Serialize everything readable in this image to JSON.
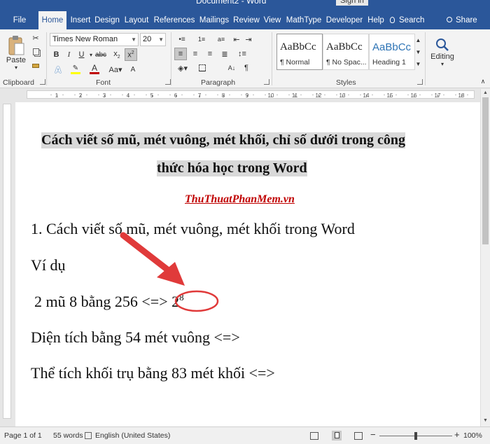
{
  "window": {
    "title": "Document2 - Word",
    "signin_label": "Sign in"
  },
  "tabs": [
    {
      "label": "File",
      "active": false
    },
    {
      "label": "Home",
      "active": true
    },
    {
      "label": "Insert",
      "active": false
    },
    {
      "label": "Design",
      "active": false
    },
    {
      "label": "Layout",
      "active": false
    },
    {
      "label": "References",
      "active": false
    },
    {
      "label": "Mailings",
      "active": false
    },
    {
      "label": "Review",
      "active": false
    },
    {
      "label": "View",
      "active": false
    },
    {
      "label": "MathType",
      "active": false
    },
    {
      "label": "Developer",
      "active": false
    },
    {
      "label": "Help",
      "active": false
    }
  ],
  "tell_me": {
    "icon": "lightbulb-icon",
    "label": "Search"
  },
  "share": {
    "icon": "person-icon",
    "label": "Share"
  },
  "ribbon": {
    "clipboard": {
      "paste_label": "Paste",
      "group_label": "Clipboard"
    },
    "font": {
      "name": "Times New Roman",
      "size": "20",
      "group_label": "Font",
      "font_color": "#c00000",
      "highlight_color": "#ffff00"
    },
    "paragraph": {
      "group_label": "Paragraph"
    },
    "styles": {
      "group_label": "Styles",
      "items": [
        {
          "sample": "AaBbCc",
          "name": "¶ Normal",
          "selected": true
        },
        {
          "sample": "AaBbCc",
          "name": "¶ No Spac...",
          "selected": false
        },
        {
          "sample": "AaBbCc",
          "name": "Heading 1",
          "selected": false,
          "color": "#2e74b5"
        }
      ]
    },
    "editing": {
      "label": "Editing"
    }
  },
  "ruler": {
    "marks": [
      "1",
      "2",
      "3",
      "4",
      "5",
      "6",
      "7",
      "8",
      "9",
      "10",
      "11",
      "12",
      "13",
      "14",
      "15",
      "16",
      "17",
      "18"
    ]
  },
  "document": {
    "title_line1": "Cách viết số mũ, mét vuông, mét khối, chỉ số dưới trong công",
    "title_line2": "thức hóa học trong Word",
    "site": "ThuThuatPhanMem.vn",
    "section1": "1. Cách viết số mũ, mét vuông, mét khối trong Word",
    "example_label": "Ví dụ",
    "example1_text": "2 mũ 8 bằng 256 <=> 2",
    "example1_sup": "8",
    "example2_text": "Diện tích bằng 54 mét vuông <=>",
    "example3_text": "Thể tích khối trụ bằng 83 mét khối <=>",
    "annotation_color": "#e03a3a"
  },
  "status": {
    "page": "Page 1 of 1",
    "words": "55 words",
    "language": "English (United States)",
    "zoom": "100%"
  }
}
